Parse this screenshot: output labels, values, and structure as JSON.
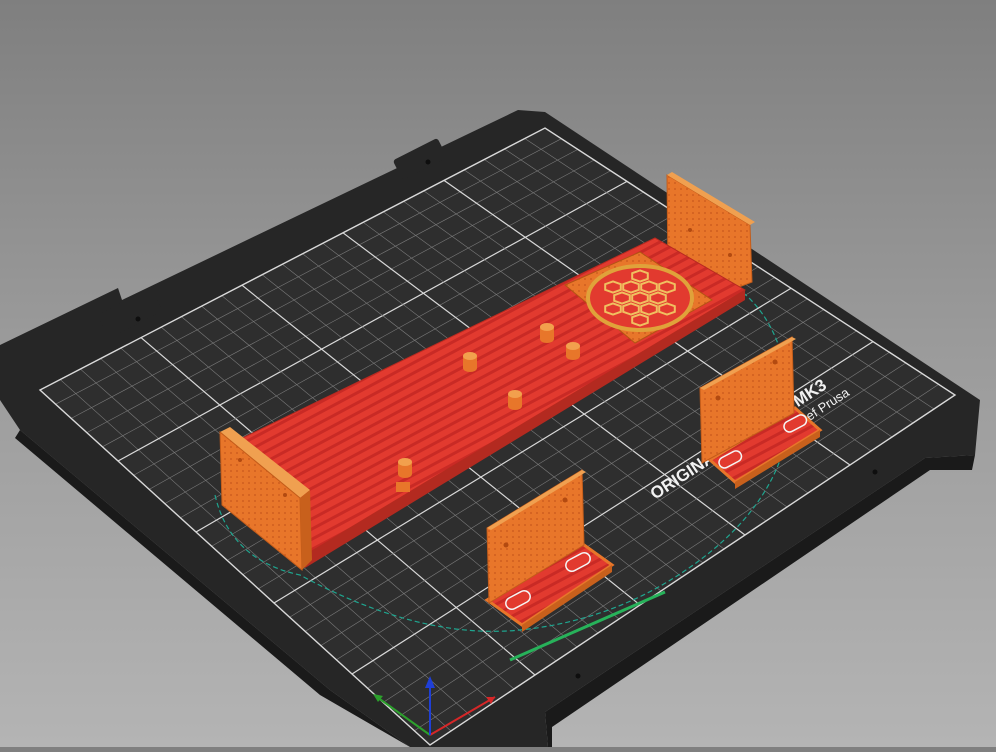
{
  "viewport": {
    "bed_label_line1": "ORIGINAL PRUSA i3 MK3",
    "bed_label_line2": "by Josef Prusa",
    "colors": {
      "background_top": "#7f7f7f",
      "background_bottom": "#b4b4b4",
      "bed": "#2b2b2b",
      "grid_major": "#d9d9d9",
      "grid_minor": "#8a8a8a",
      "model_top": "#e23a2f",
      "model_wall": "#e8762a",
      "skirt": "#1fa58f",
      "axis_x": "#d62728",
      "axis_y": "#2ca02c",
      "axis_z": "#1f3fd6"
    },
    "objects": [
      {
        "name": "long-base-plate-with-fan-grille"
      },
      {
        "name": "mounting-bracket-front"
      },
      {
        "name": "mounting-bracket-right"
      }
    ]
  }
}
